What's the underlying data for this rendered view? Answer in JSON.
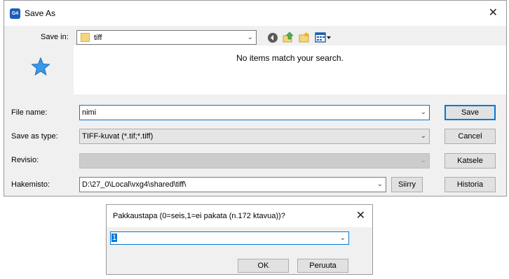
{
  "save_dialog": {
    "title": "Save As",
    "app_icon_text": "G4",
    "save_in": {
      "label": "Save in:",
      "value": "tiff"
    },
    "empty_message": "No items match your search.",
    "file_name": {
      "label": "File name:",
      "value": "nimi"
    },
    "save_as_type": {
      "label": "Save as type:",
      "value": "TIFF-kuvat (*.tif;*.tiff)"
    },
    "revisio": {
      "label": "Revisio:",
      "value": ""
    },
    "hakemisto": {
      "label": "Hakemisto:",
      "value": "D:\\27_0\\Local\\vxg4\\shared\\tiff\\"
    },
    "buttons": {
      "save": "Save",
      "cancel": "Cancel",
      "katsele": "Katsele",
      "siirry": "Siirry",
      "historia": "Historia"
    }
  },
  "compress_dialog": {
    "prompt": "Pakkaustapa (0=seis,1=ei pakata (n.172 ktavua))?",
    "value": "1",
    "ok": "OK",
    "cancel": "Peruuta"
  }
}
